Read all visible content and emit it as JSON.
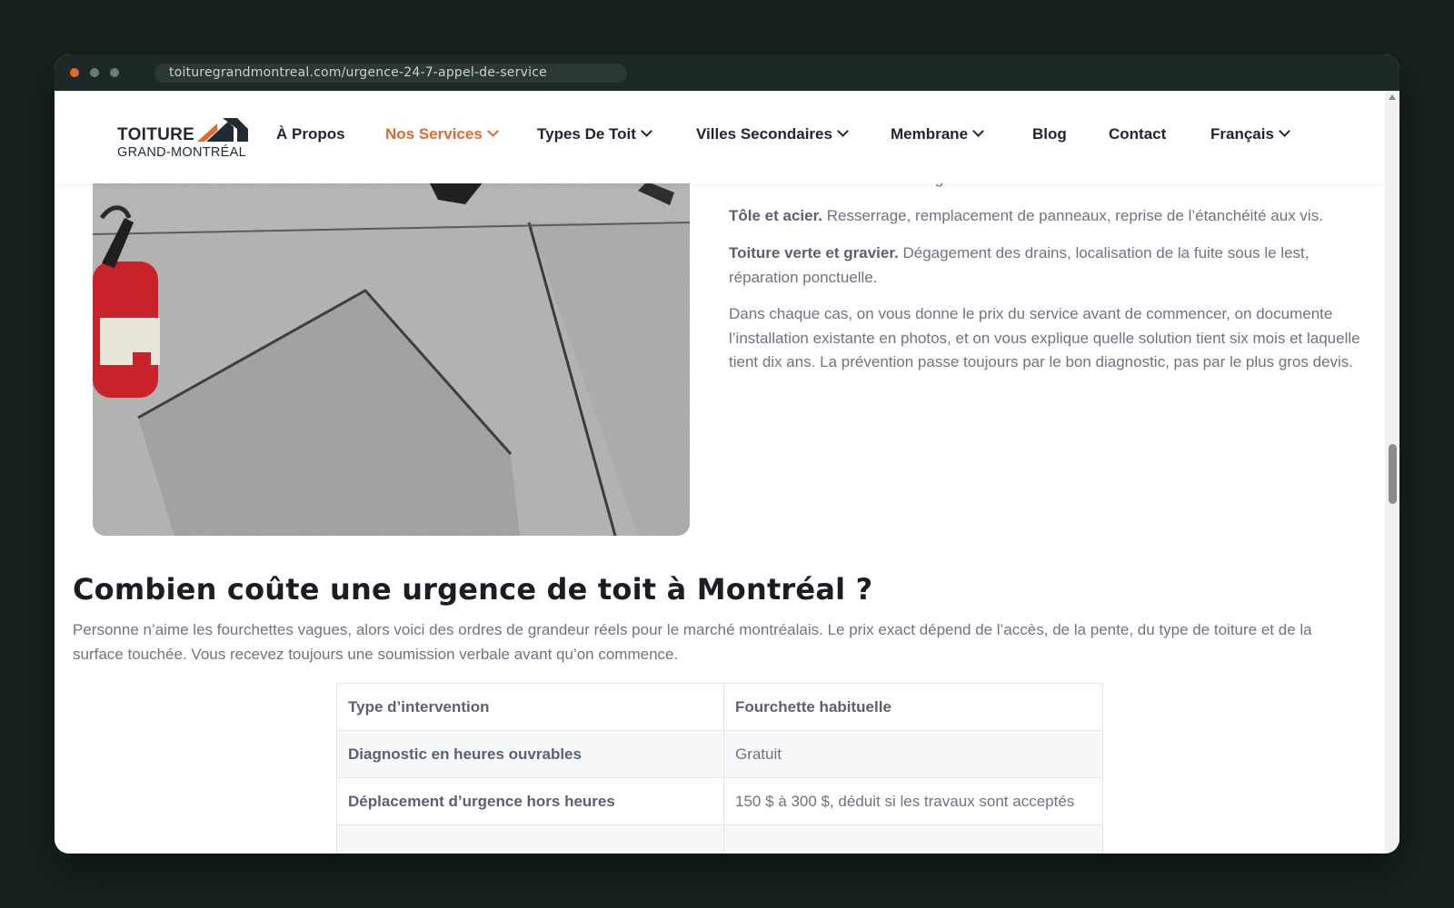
{
  "browser": {
    "url": "toituregrandmontreal.com/urgence-24-7-appel-de-service"
  },
  "logo": {
    "line1": "TOITURE",
    "line2": "GRAND-MONTRÉAL"
  },
  "nav": {
    "items": [
      {
        "label": "À Propos"
      },
      {
        "label": "Nos Services"
      },
      {
        "label": "Types De Toit"
      },
      {
        "label": "Villes Secondaires"
      },
      {
        "label": "Membrane"
      },
      {
        "label": "Blog"
      },
      {
        "label": "Contact"
      },
      {
        "label": "Français"
      }
    ]
  },
  "content": {
    "partial_text": "révision des drains et des margelles.",
    "items": [
      {
        "title": "Tôle et acier.",
        "text": "Resserrage, remplacement de panneaux, reprise de l’étanchéité aux vis."
      },
      {
        "title": "Toiture verte et gravier.",
        "text": "Dégagement des drains, localisation de la fuite sous le lest, réparation ponctuelle."
      }
    ],
    "paragraph": "Dans chaque cas, on vous donne le prix du service avant de commencer, on documente l’installation existante en photos, et on vous explique quelle solution tient six mois et laquelle tient dix ans. La prévention passe toujours par le bon diagnostic, pas par le plus gros devis."
  },
  "section": {
    "heading": "Combien coûte une urgence de toit à Montréal ?",
    "intro": "Personne n’aime les fourchettes vagues, alors voici des ordres de grandeur réels pour le marché montréalais. Le prix exact dépend de l’accès, de la pente, du type de toiture et de la surface touchée. Vous recevez toujours une soumission verbale avant qu’on commence."
  },
  "table": {
    "headers": [
      "Type d’intervention",
      "Fourchette habituelle"
    ],
    "rows": [
      {
        "type": "Diagnostic en heures ouvrables",
        "range": "Gratuit"
      },
      {
        "type": "Déplacement d’urgence hors heures",
        "range": "150 $ à 300 $, déduit si les travaux sont acceptés"
      }
    ]
  },
  "colors": {
    "accent": "#e0692e",
    "text": "#6f7281",
    "heading": "#1a1d24",
    "nav": "#1e2433"
  }
}
